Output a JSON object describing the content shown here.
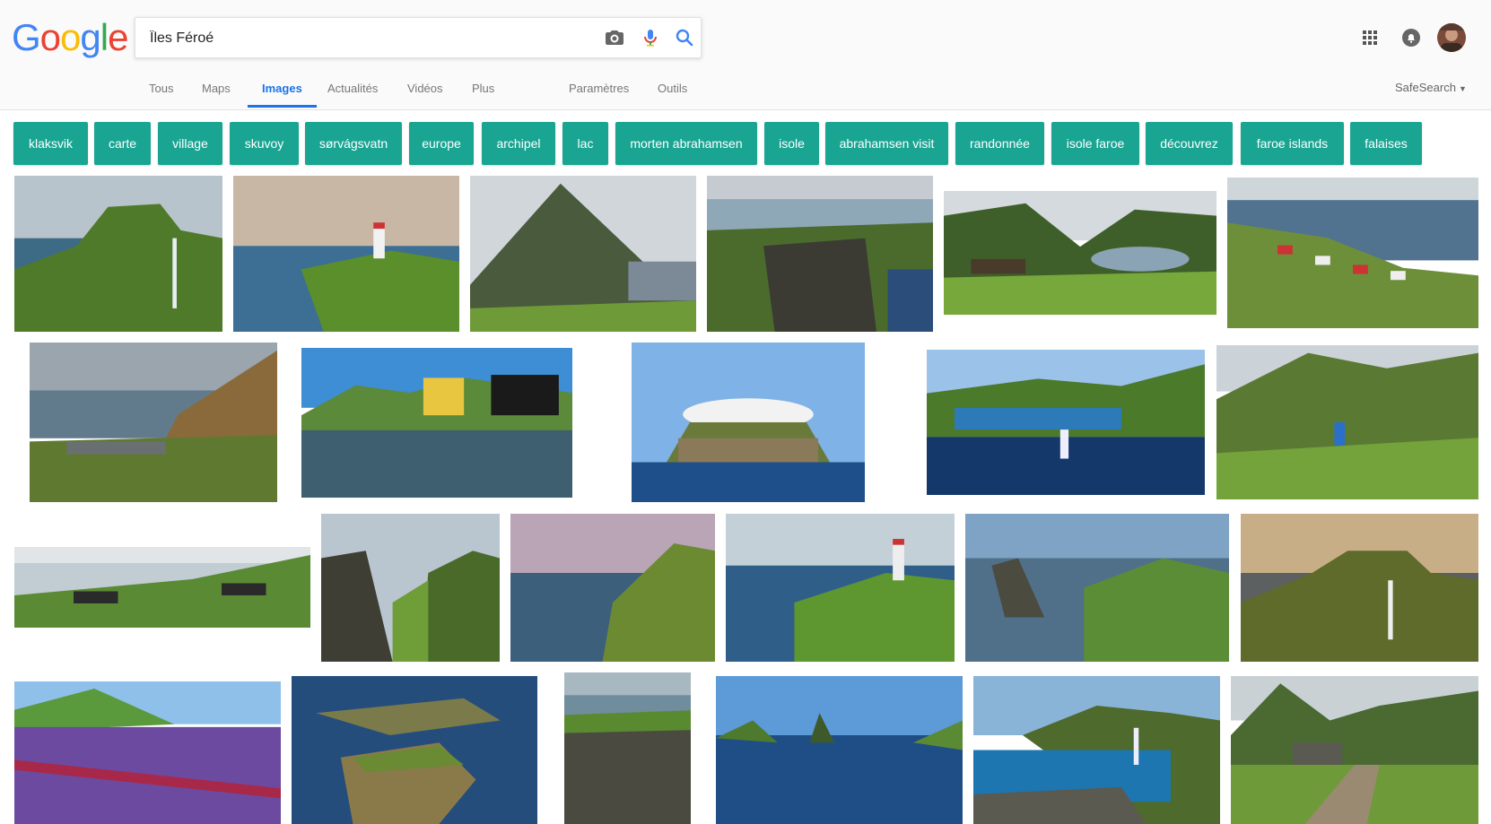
{
  "search": {
    "query": "Îles Féroé"
  },
  "logo": {
    "letters": [
      "G",
      "o",
      "o",
      "g",
      "l",
      "e"
    ],
    "colors": [
      "#4285F4",
      "#EA4335",
      "#FBBC05",
      "#4285F4",
      "#34A853",
      "#EA4335"
    ]
  },
  "tabs": [
    {
      "label": "Tous"
    },
    {
      "label": "Maps"
    },
    {
      "label": "Images"
    },
    {
      "label": "Actualités"
    },
    {
      "label": "Vidéos"
    },
    {
      "label": "Plus"
    },
    {
      "label": "Paramètres"
    },
    {
      "label": "Outils"
    }
  ],
  "safesearch_label": "SafeSearch",
  "chips": [
    {
      "label": "klaksvik"
    },
    {
      "label": "carte"
    },
    {
      "label": "village"
    },
    {
      "label": "skuvoy"
    },
    {
      "label": "sørvágsvatn"
    },
    {
      "label": "europe"
    },
    {
      "label": "archipel"
    },
    {
      "label": "lac"
    },
    {
      "label": "morten abrahamsen"
    },
    {
      "label": "isole"
    },
    {
      "label": "abrahamsen visit"
    },
    {
      "label": "randonnée"
    },
    {
      "label": "isole faroe"
    },
    {
      "label": "découvrez"
    },
    {
      "label": "faroe islands"
    },
    {
      "label": "falaises"
    }
  ],
  "icons": {
    "camera": "camera-icon",
    "mic": "microphone-icon",
    "search": "search-icon",
    "apps": "apps-grid-icon",
    "notifications": "notifications-icon",
    "avatar": "avatar"
  },
  "colors": {
    "accent": "#1a73e8",
    "chip": "#1aa593"
  }
}
